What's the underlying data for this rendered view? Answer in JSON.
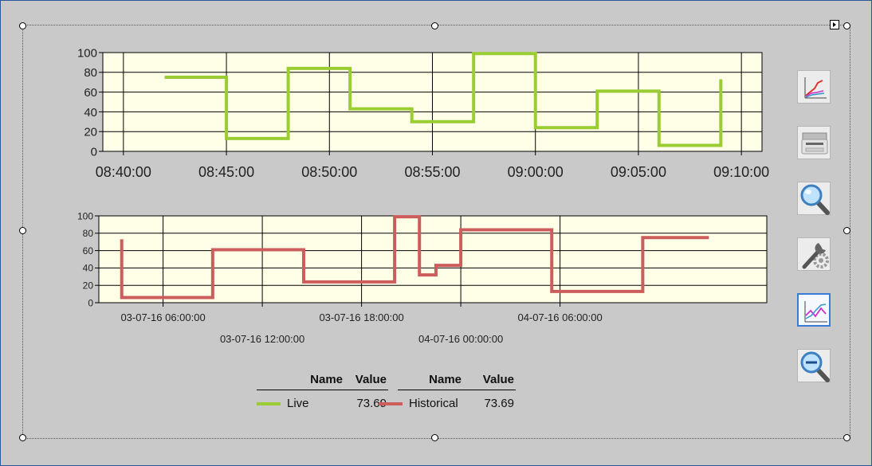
{
  "toolbar": {
    "buttons": [
      {
        "name": "chart-view-button",
        "icon": "line-chart-icon",
        "active": true
      },
      {
        "name": "print-button",
        "icon": "printer-icon",
        "active": false
      },
      {
        "name": "zoom-in-button",
        "icon": "magnifier-icon",
        "active": false
      },
      {
        "name": "settings-button",
        "icon": "wrench-gear-icon",
        "active": false
      },
      {
        "name": "trend-button",
        "icon": "trend-lines-icon",
        "active": true
      },
      {
        "name": "zoom-out-button",
        "icon": "zoom-out-icon",
        "active": false
      }
    ]
  },
  "legend": {
    "headers": [
      "Name",
      "Value",
      "Name",
      "Value"
    ],
    "items": [
      {
        "name": "Live",
        "value": "73.69",
        "color": "#9acd32"
      },
      {
        "name": "Historical",
        "value": "73.69",
        "color": "#cd5c5c"
      }
    ]
  },
  "chart_data": [
    {
      "type": "line",
      "series": [
        {
          "name": "Live",
          "color": "#9acd32",
          "step": true,
          "points": [
            [
              "08:42:00",
              75
            ],
            [
              "08:45:00",
              13
            ],
            [
              "08:48:00",
              84
            ],
            [
              "08:51:00",
              43
            ],
            [
              "08:54:00",
              30
            ],
            [
              "08:57:00",
              99
            ],
            [
              "09:00:00",
              24
            ],
            [
              "09:03:00",
              61
            ],
            [
              "09:06:00",
              6
            ],
            [
              "09:09:00",
              73
            ]
          ]
        }
      ],
      "x_ticks": [
        "08:40:00",
        "08:45:00",
        "08:50:00",
        "08:55:00",
        "09:00:00",
        "09:05:00",
        "09:10:00"
      ],
      "xlim": [
        "08:39:00",
        "09:11:00"
      ],
      "y_ticks": [
        "0",
        "20",
        "40",
        "60",
        "80",
        "100"
      ],
      "ylim": [
        0,
        100
      ],
      "grid": true,
      "background": "#ffffe8"
    },
    {
      "type": "line",
      "series": [
        {
          "name": "Historical",
          "color": "#cd5c5c",
          "step": true,
          "points": [
            [
              "03-07-16 03:30:00",
              73
            ],
            [
              "03-07-16 03:30:00",
              6
            ],
            [
              "03-07-16 09:00:00",
              61
            ],
            [
              "03-07-16 14:30:00",
              24
            ],
            [
              "03-07-16 20:00:00",
              99
            ],
            [
              "03-07-16 21:30:00",
              32
            ],
            [
              "03-07-16 22:30:00",
              43
            ],
            [
              "04-07-16 00:00:00",
              84
            ],
            [
              "04-07-16 05:30:00",
              13
            ],
            [
              "04-07-16 11:00:00",
              75
            ],
            [
              "04-07-16 15:00:00",
              75
            ]
          ]
        }
      ],
      "x_ticks": [
        "03-07-16 06:00:00",
        "03-07-16 12:00:00",
        "03-07-16 18:00:00",
        "04-07-16 00:00:00",
        "04-07-16 06:00:00"
      ],
      "y_ticks": [
        "0",
        "20",
        "40",
        "60",
        "80",
        "100"
      ],
      "ylim": [
        0,
        100
      ],
      "grid": true,
      "background": "#ffffe8"
    }
  ]
}
